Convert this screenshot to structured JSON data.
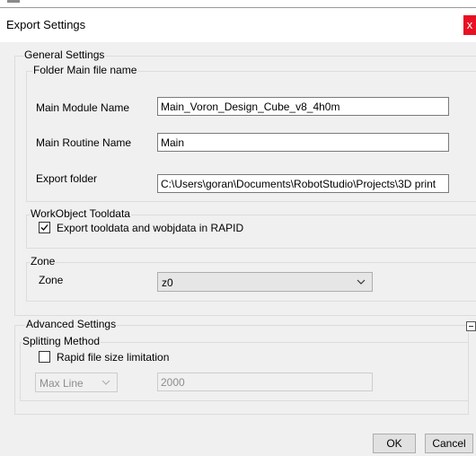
{
  "window": {
    "title": "Export Settings",
    "close_label": "x"
  },
  "general": {
    "legend": "General Settings",
    "folder_legend": "Folder  Main file name",
    "main_module_label": "Main Module Name",
    "main_module_value": "Main_Voron_Design_Cube_v8_4h0m",
    "main_routine_label": "Main Routine Name",
    "main_routine_value": "Main",
    "export_folder_label": "Export folder",
    "export_folder_value": "C:\\Users\\goran\\Documents\\RobotStudio\\Projects\\3D print"
  },
  "workobject": {
    "legend": "WorkObject  Tooldata",
    "checkbox_label": "Export tooldata and wobjdata in RAPID",
    "checked": true
  },
  "zone": {
    "legend": "Zone",
    "label": "Zone",
    "selected": "z0"
  },
  "advanced": {
    "legend": "Advanced Settings",
    "splitting_legend": "Splitting Method",
    "rapid_limit_label": "Rapid file size limitation",
    "rapid_limit_checked": false,
    "method_selected": "Max Line",
    "limit_value": "2000"
  },
  "buttons": {
    "ok": "OK",
    "cancel": "Cancel"
  },
  "icons": {
    "close": "close-icon",
    "check": "checkmark-icon",
    "dropdown": "chevron-down-icon",
    "collapse": "collapse-minus-icon"
  }
}
